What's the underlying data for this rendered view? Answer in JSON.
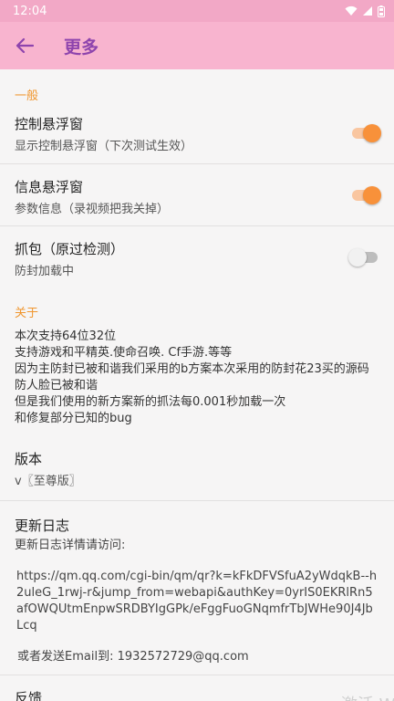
{
  "status": {
    "time": "12:04"
  },
  "app_bar": {
    "title": "更多"
  },
  "general": {
    "header": "一般",
    "items": [
      {
        "title": "控制悬浮窗",
        "subtitle": "显示控制悬浮窗（下次测试生效）",
        "switch_on": true
      },
      {
        "title": "信息悬浮窗",
        "subtitle": "参数信息（录视频把我关掉）",
        "switch_on": true
      },
      {
        "title": "抓包（原过检测）",
        "subtitle": "防封加载中",
        "switch_on": false
      }
    ]
  },
  "about": {
    "header": "关于",
    "lines": [
      "本次支持64位32位",
      "支持游戏和平精英.使命召唤. Cf手游.等等",
      "因为主防封已被和谐我们采用的b方案本次采用的防封花23买的源码",
      "防人脸已被和谐",
      "但是我们使用的新方案新的抓法每0.001秒加载一次",
      "和修复部分已知的bug"
    ]
  },
  "version": {
    "title": "版本",
    "value": "v〖至尊版〗"
  },
  "changelog": {
    "title": "更新日志",
    "intro": "更新日志详情请访问:",
    "url": "https://qm.qq.com/cgi-bin/qm/qr?k=kFkDFVSfuA2yWdqkB--h2uleG_1rwj-r&jump_from=webapi&authKey=0yrIS0EKRlRn5afOWQUtmEnpwSRDBYIgGPk/eFggFuoGNqmfrTbJWHe90J4JbLcq",
    "email_line": "或者发送Email到: 1932572729@qq.com"
  },
  "feedback": {
    "title": "反馈"
  },
  "watermark": "激活 Wi",
  "colors": {
    "app_bar": "#f8b4cf",
    "title": "#8e44ad",
    "accent": "#f8913a",
    "section": "#f0962e"
  }
}
